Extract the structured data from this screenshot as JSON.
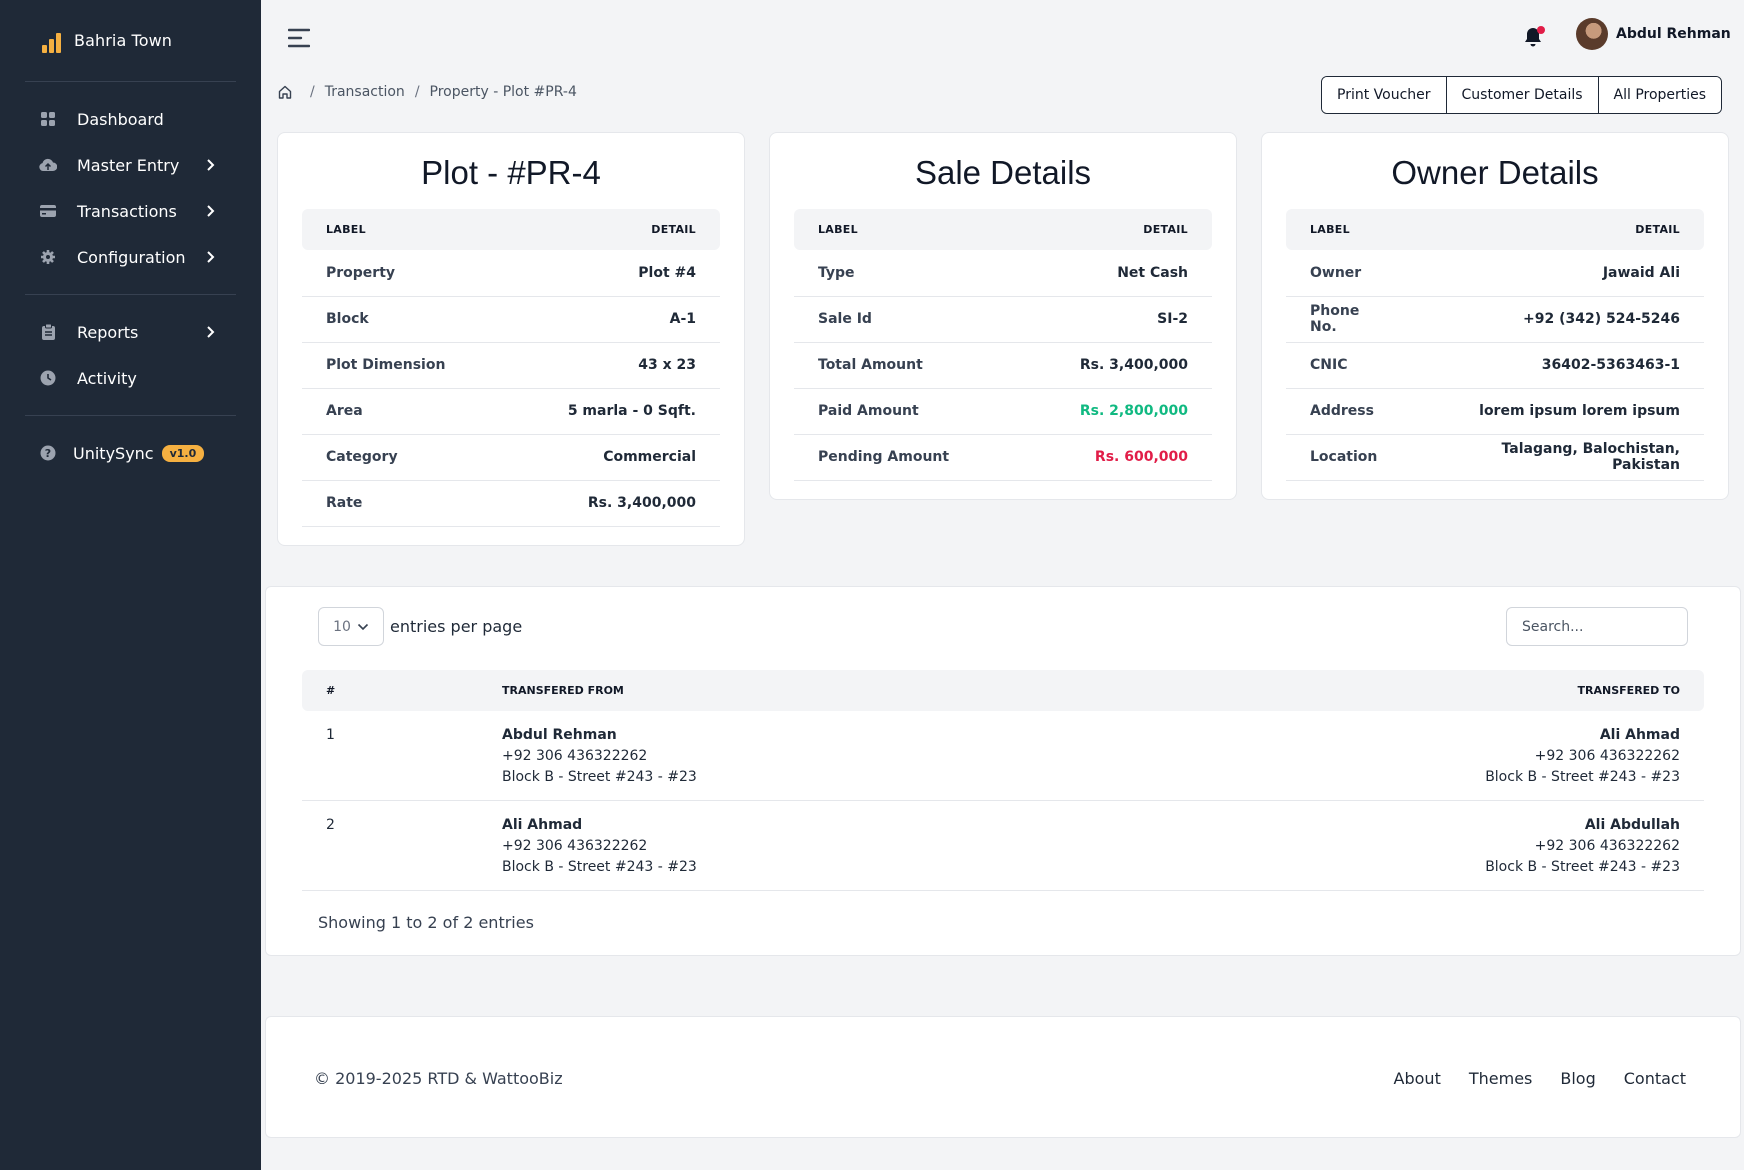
{
  "sidebar": {
    "brand": "Bahria Town",
    "items": [
      {
        "label": "Dashboard",
        "icon": "grid-icon",
        "has_chevron": false
      },
      {
        "label": "Master Entry",
        "icon": "cloud-icon",
        "has_chevron": true
      },
      {
        "label": "Transactions",
        "icon": "card-icon",
        "has_chevron": true
      },
      {
        "label": "Configuration",
        "icon": "gear-icon",
        "has_chevron": true
      }
    ],
    "items2": [
      {
        "label": "Reports",
        "icon": "clipboard-icon",
        "has_chevron": true
      },
      {
        "label": "Activity",
        "icon": "clock-icon",
        "has_chevron": false
      }
    ],
    "app": {
      "label": "UnitySync",
      "version": "v1.0",
      "icon": "help-icon"
    }
  },
  "topbar": {
    "user_name": "Abdul Rehman"
  },
  "breadcrumb": {
    "items": [
      "Transaction",
      "Property - Plot #PR-4"
    ]
  },
  "actions": [
    "Print Voucher",
    "Customer Details",
    "All Properties"
  ],
  "plot_card": {
    "title": "Plot - #PR-4",
    "col_label": "LABEL",
    "col_detail": "DETAIL",
    "rows": [
      {
        "label": "Property",
        "value": "Plot #4"
      },
      {
        "label": "Block",
        "value": "A-1"
      },
      {
        "label": "Plot Dimension",
        "value": "43 x 23"
      },
      {
        "label": "Area",
        "value": "5 marla - 0 Sqft."
      },
      {
        "label": "Category",
        "value": "Commercial"
      },
      {
        "label": "Rate",
        "value": "Rs. 3,400,000"
      }
    ]
  },
  "sale_card": {
    "title": "Sale Details",
    "col_label": "LABEL",
    "col_detail": "DETAIL",
    "rows": [
      {
        "label": "Type",
        "value": "Net Cash"
      },
      {
        "label": "Sale Id",
        "value": "SI-2"
      },
      {
        "label": "Total Amount",
        "value": "Rs. 3,400,000"
      },
      {
        "label": "Paid Amount",
        "value": "Rs. 2,800,000"
      },
      {
        "label": "Pending Amount",
        "value": "Rs. 600,000"
      }
    ],
    "colors": {
      "paid": "#10b981",
      "pending": "#e11d48"
    }
  },
  "owner_card": {
    "title": "Owner Details",
    "col_label": "LABEL",
    "col_detail": "DETAIL",
    "rows": [
      {
        "label": "Owner",
        "value": "Jawaid Ali"
      },
      {
        "label": "Phone No.",
        "value": "+92 (342) 524-5246"
      },
      {
        "label": "CNIC",
        "value": "36402-5363463-1"
      },
      {
        "label": "Address",
        "value": "lorem ipsum lorem ipsum"
      },
      {
        "label": "Location",
        "value": "Talagang, Balochistan, Pakistan"
      }
    ]
  },
  "transfers": {
    "per_page_value": "10",
    "per_page_label": "entries per page",
    "search_placeholder": "Search...",
    "headers": [
      "#",
      "TRANSFERED FROM",
      "TRANSFERED TO"
    ],
    "rows": [
      {
        "num": "1",
        "from": {
          "name": "Abdul Rehman",
          "phone": "+92 306 436322262",
          "address": "Block B - Street #243 - #23"
        },
        "to": {
          "name": "Ali Ahmad",
          "phone": "+92 306 436322262",
          "address": "Block B - Street #243 - #23"
        }
      },
      {
        "num": "2",
        "from": {
          "name": "Ali Ahmad",
          "phone": "+92 306 436322262",
          "address": "Block B - Street #243 - #23"
        },
        "to": {
          "name": "Ali Abdullah",
          "phone": "+92 306 436322262",
          "address": "Block B - Street #243 - #23"
        }
      }
    ],
    "showing": "Showing 1 to 2 of 2 entries"
  },
  "footer": {
    "copyright": "© 2019-2025 RTD & WattooBiz",
    "links": [
      "About",
      "Themes",
      "Blog",
      "Contact"
    ]
  },
  "colors": {
    "sidebar_bg": "#1f2937",
    "accent": "#f5b041",
    "page_bg": "#f3f4f6"
  }
}
